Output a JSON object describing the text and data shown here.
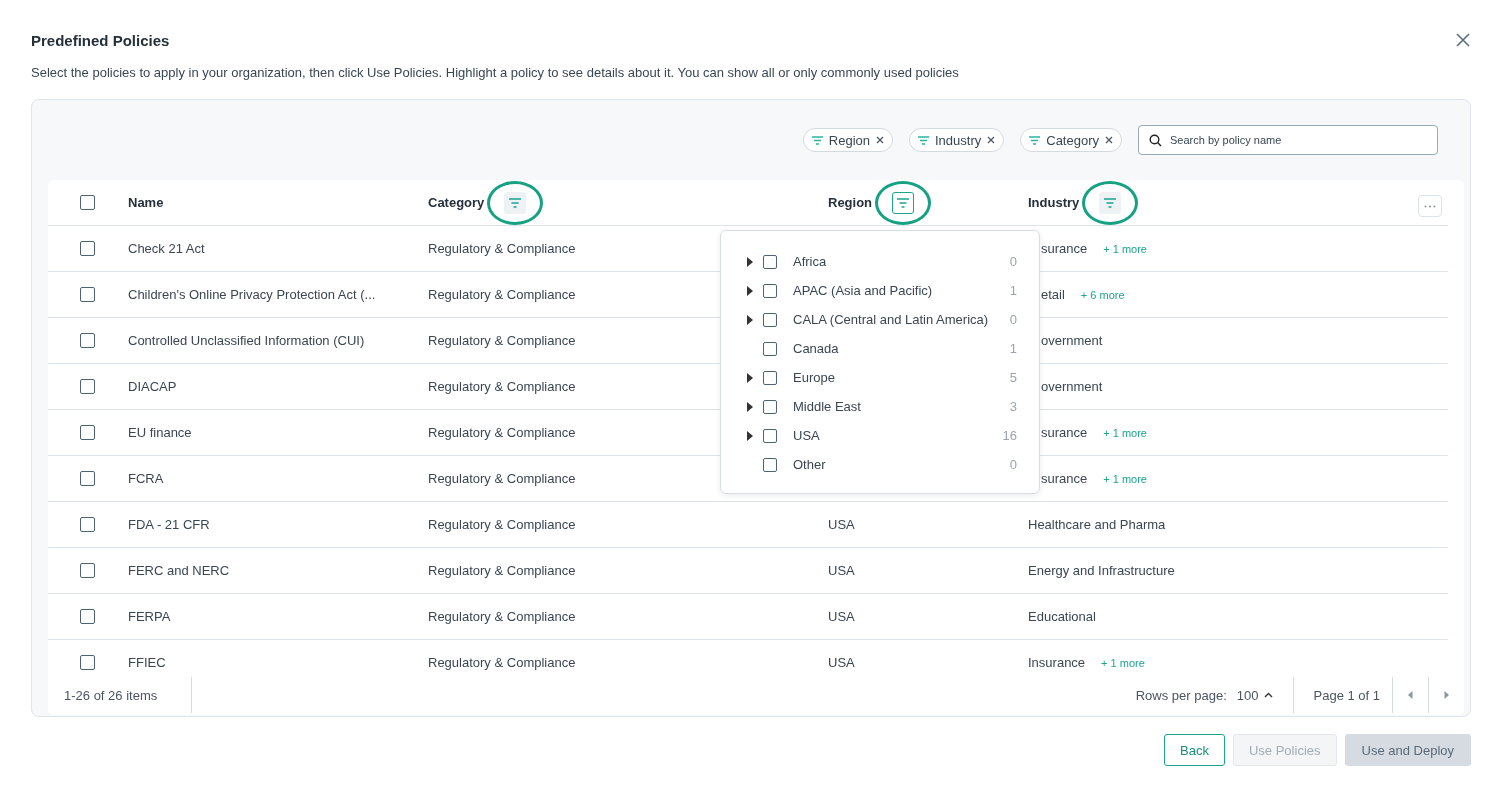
{
  "dialog": {
    "title": "Predefined Policies",
    "description": "Select the policies to apply in your organization, then click Use Policies. Highlight a policy to see details about it. You can show all or only commonly used policies"
  },
  "filter_chips": [
    {
      "label": "Region"
    },
    {
      "label": "Industry"
    },
    {
      "label": "Category"
    }
  ],
  "search": {
    "placeholder": "Search by policy name"
  },
  "table": {
    "select_all": {
      "checked": false
    },
    "columns": [
      {
        "label": "Name",
        "filter": false
      },
      {
        "label": "Category",
        "filter": true,
        "active": false,
        "highlighted": true
      },
      {
        "label": "Region",
        "filter": true,
        "active": true,
        "highlighted": true
      },
      {
        "label": "Industry",
        "filter": true,
        "active": false,
        "highlighted": true
      }
    ],
    "rows": [
      {
        "checked": false,
        "name": "Check 21 Act",
        "category": "Regulatory & Compliance",
        "industry": "surance",
        "more": "+ 1 more"
      },
      {
        "checked": false,
        "name": "Children's Online Privacy Protection Act (...",
        "category": "Regulatory & Compliance",
        "industry": "etail",
        "more": "+ 6 more"
      },
      {
        "checked": false,
        "name": "Controlled Unclassified Information (CUI)",
        "category": "Regulatory & Compliance",
        "industry": "overnment"
      },
      {
        "checked": false,
        "name": "DIACAP",
        "category": "Regulatory & Compliance",
        "industry": "overnment"
      },
      {
        "checked": false,
        "name": "EU finance",
        "category": "Regulatory & Compliance",
        "industry": "surance",
        "more": "+ 1 more"
      },
      {
        "checked": false,
        "name": "FCRA",
        "category": "Regulatory & Compliance",
        "industry": "surance",
        "more": "+ 1 more"
      },
      {
        "checked": false,
        "name": "FDA - 21 CFR",
        "category": "Regulatory & Compliance",
        "region": "USA",
        "industry": "Healthcare and Pharma"
      },
      {
        "checked": false,
        "name": "FERC and NERC",
        "category": "Regulatory & Compliance",
        "region": "USA",
        "industry": "Energy and Infrastructure"
      },
      {
        "checked": false,
        "name": "FERPA",
        "category": "Regulatory & Compliance",
        "region": "USA",
        "industry": "Educational"
      },
      {
        "checked": false,
        "name": "FFIEC",
        "category": "Regulatory & Compliance",
        "region": "USA",
        "industry": "Insurance",
        "more": "+ 1 more"
      }
    ]
  },
  "region_dropdown": {
    "items": [
      {
        "label": "Africa",
        "count": "0",
        "expandable": true,
        "checked": false
      },
      {
        "label": "APAC (Asia and Pacific)",
        "count": "1",
        "expandable": true,
        "checked": false
      },
      {
        "label": "CALA (Central and Latin America)",
        "count": "0",
        "expandable": true,
        "checked": false
      },
      {
        "label": "Canada",
        "count": "1",
        "expandable": false,
        "checked": false
      },
      {
        "label": "Europe",
        "count": "5",
        "expandable": true,
        "checked": false
      },
      {
        "label": "Middle East",
        "count": "3",
        "expandable": true,
        "checked": false
      },
      {
        "label": "USA",
        "count": "16",
        "expandable": true,
        "checked": false
      },
      {
        "label": "Other",
        "count": "0",
        "expandable": false,
        "checked": false
      }
    ]
  },
  "pagination": {
    "summary": "1-26 of 26 items",
    "rows_label": "Rows per page:",
    "rows_value": "100",
    "page": "Page 1 of 1"
  },
  "buttons": [
    {
      "label": "Back",
      "kind": "secondary",
      "disabled": false
    },
    {
      "label": "Use Policies",
      "kind": "secondary",
      "disabled": true
    },
    {
      "label": "Use and Deploy",
      "kind": "primary",
      "disabled": true
    }
  ]
}
